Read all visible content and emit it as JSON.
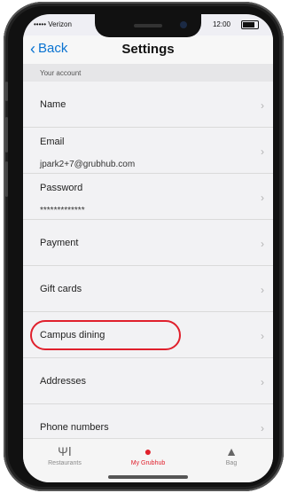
{
  "status_bar": {
    "carrier": "••••• Verizon",
    "time": "12:00"
  },
  "nav": {
    "back_label": "Back",
    "title": "Settings"
  },
  "section_header": "Your account",
  "rows": [
    {
      "label": "Name",
      "sub": ""
    },
    {
      "label": "Email",
      "sub": "jpark2+7@grubhub.com"
    },
    {
      "label": "Password",
      "sub": "*************"
    },
    {
      "label": "Payment",
      "sub": ""
    },
    {
      "label": "Gift cards",
      "sub": ""
    },
    {
      "label": "Campus dining",
      "sub": ""
    },
    {
      "label": "Addresses",
      "sub": ""
    },
    {
      "label": "Phone numbers",
      "sub": ""
    }
  ],
  "tabs": [
    {
      "label": "Restaurants",
      "icon": "fork-knife-icon"
    },
    {
      "label": "My Grubhub",
      "icon": "person-icon"
    },
    {
      "label": "Bag",
      "icon": "bag-icon"
    }
  ],
  "colors": {
    "accent": "#e0202c",
    "link": "#0a73d1"
  }
}
